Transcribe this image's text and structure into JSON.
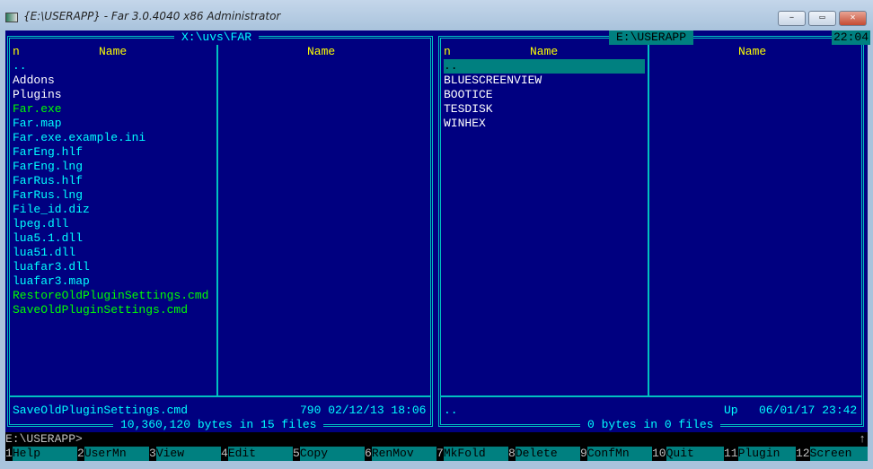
{
  "window": {
    "title": "{E:\\USERAPP} - Far 3.0.4040 x86 Administrator",
    "minimize": "‒",
    "maximize": "▭",
    "close": "✕"
  },
  "left_panel": {
    "path": "X:\\uvs\\FAR",
    "col1_n": "n",
    "col1": "Name",
    "col2": "Name",
    "files": [
      {
        "name": "..",
        "color": "cyan"
      },
      {
        "name": "Addons",
        "color": "white"
      },
      {
        "name": "Plugins",
        "color": "white"
      },
      {
        "name": "Far.exe",
        "color": "green"
      },
      {
        "name": "Far.map",
        "color": "cyan"
      },
      {
        "name": "Far.exe.example.ini",
        "color": "cyan"
      },
      {
        "name": "FarEng.hlf",
        "color": "cyan"
      },
      {
        "name": "FarEng.lng",
        "color": "cyan"
      },
      {
        "name": "FarRus.hlf",
        "color": "cyan"
      },
      {
        "name": "FarRus.lng",
        "color": "cyan"
      },
      {
        "name": "File_id.diz",
        "color": "cyan"
      },
      {
        "name": "lpeg.dll",
        "color": "cyan"
      },
      {
        "name": "lua5.1.dll",
        "color": "cyan"
      },
      {
        "name": "lua51.dll",
        "color": "cyan"
      },
      {
        "name": "luafar3.dll",
        "color": "cyan"
      },
      {
        "name": "luafar3.map",
        "color": "cyan"
      },
      {
        "name": "RestoreOldPluginSettings.cmd",
        "color": "green"
      },
      {
        "name": "SaveOldPluginSettings.cmd",
        "color": "green"
      }
    ],
    "status_name": "SaveOldPluginSettings.cmd",
    "status_info": "790 02/12/13 18:06",
    "summary": "10,360,120 bytes in 15 files"
  },
  "right_panel": {
    "path": "E:\\USERAPP",
    "clock": "22:04",
    "col1_n": "n",
    "col1": "Name",
    "col2": "Name",
    "files": [
      {
        "name": ".."
      },
      {
        "name": "BLUESCREENVIEW"
      },
      {
        "name": "BOOTICE"
      },
      {
        "name": "TESDISK"
      },
      {
        "name": "WINHEX"
      }
    ],
    "status_name": "..",
    "status_info": "Up   06/01/17 23:42",
    "summary": "0 bytes in 0 files"
  },
  "command_line": {
    "prompt": "E:\\USERAPP>",
    "scroll_indicator": "↑"
  },
  "keybar": [
    {
      "num": "1",
      "label": "Help"
    },
    {
      "num": "2",
      "label": "UserMn"
    },
    {
      "num": "3",
      "label": "View"
    },
    {
      "num": "4",
      "label": "Edit"
    },
    {
      "num": "5",
      "label": "Copy"
    },
    {
      "num": "6",
      "label": "RenMov"
    },
    {
      "num": "7",
      "label": "MkFold"
    },
    {
      "num": "8",
      "label": "Delete"
    },
    {
      "num": "9",
      "label": "ConfMn"
    },
    {
      "num": "10",
      "label": "Quit"
    },
    {
      "num": "11",
      "label": "Plugin"
    },
    {
      "num": "12",
      "label": "Screen"
    }
  ]
}
